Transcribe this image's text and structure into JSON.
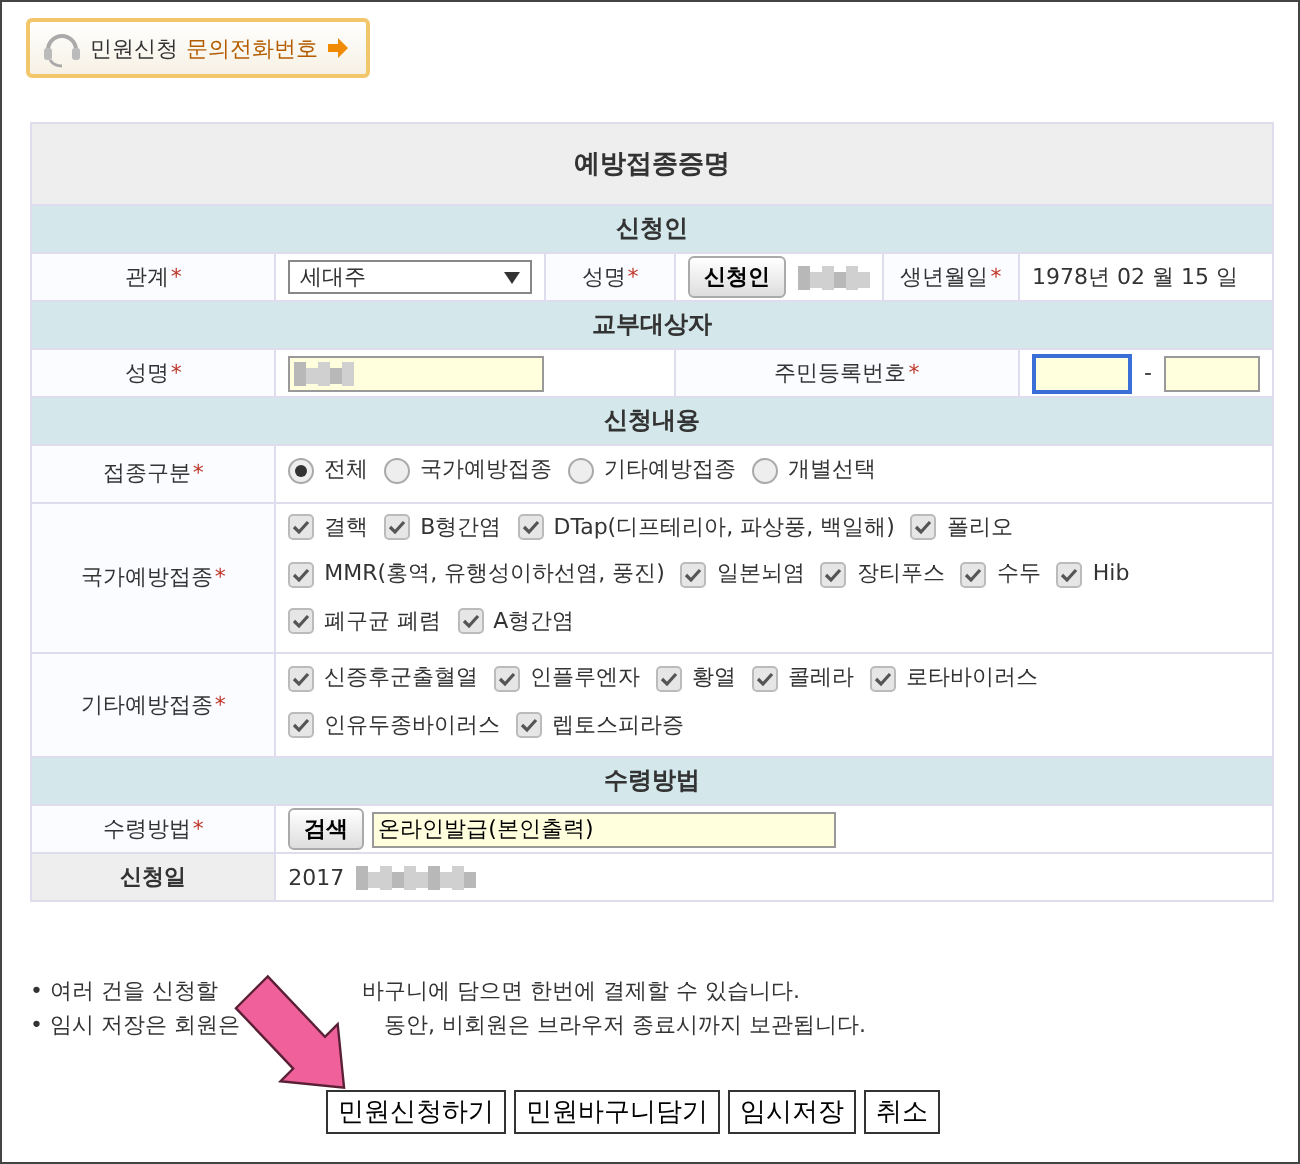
{
  "badge": {
    "label": "민원신청",
    "link": "문의전화번호"
  },
  "form": {
    "title": "예방접종증명",
    "applicant": {
      "heading": "신청인",
      "relation_label": "관계",
      "relation_mark": "*",
      "relation_value": "세대주",
      "name_label": "성명",
      "name_mark": "*",
      "name_button": "신청인",
      "birth_label": "생년월일",
      "birth_mark": "*",
      "birth_value": "1978년 02 월 15 일"
    },
    "recipient": {
      "heading": "교부대상자",
      "name_label": "성명",
      "name_mark": "*",
      "id_label": "주민등록번호",
      "id_mark": "*",
      "id_separator": "-"
    },
    "content": {
      "heading": "신청내용",
      "rows": [
        {
          "kind": "radio",
          "label": "접종구분",
          "mark": "*",
          "options": [
            {
              "label": "전체",
              "selected": true
            },
            {
              "label": "국가예방접종",
              "selected": false
            },
            {
              "label": "기타예방접종",
              "selected": false
            },
            {
              "label": "개별선택",
              "selected": false
            }
          ]
        },
        {
          "kind": "checkbox",
          "label": "국가예방접종",
          "mark": "*",
          "options": [
            {
              "label": "결핵",
              "checked": true
            },
            {
              "label": "B형간염",
              "checked": true
            },
            {
              "label": "DTap(디프테리아, 파상풍, 백일해)",
              "checked": true
            },
            {
              "label": "폴리오",
              "checked": true
            },
            {
              "label": "MMR(홍역, 유행성이하선염, 풍진)",
              "checked": true
            },
            {
              "label": "일본뇌염",
              "checked": true
            },
            {
              "label": "장티푸스",
              "checked": true
            },
            {
              "label": "수두",
              "checked": true
            },
            {
              "label": "Hib",
              "checked": true
            },
            {
              "label": "폐구균 폐렴",
              "checked": true
            },
            {
              "label": "A형간염",
              "checked": true
            }
          ]
        },
        {
          "kind": "checkbox",
          "label": "기타예방접종",
          "mark": "*",
          "options": [
            {
              "label": "신증후군출혈열",
              "checked": true
            },
            {
              "label": "인플루엔자",
              "checked": true
            },
            {
              "label": "황열",
              "checked": true
            },
            {
              "label": "콜레라",
              "checked": true
            },
            {
              "label": "로타바이러스",
              "checked": true
            },
            {
              "label": "인유두종바이러스",
              "checked": true
            },
            {
              "label": "렙토스피라증",
              "checked": true
            }
          ]
        }
      ]
    },
    "receipt": {
      "heading": "수령방법",
      "method_label": "수령방법",
      "method_mark": "*",
      "search_button": "검색",
      "method_value": "온라인발급(본인출력)",
      "date_label": "신청일",
      "date_value": "2017"
    }
  },
  "notes": [
    {
      "before": "• 여러 건을 신청할",
      "after": "바구니에 담으면 한번에 결제할 수 있습니다."
    },
    {
      "before": "• 임시 저장은 회원은",
      "after": "동안, 비회원은 브라우저 종료시까지 보관됩니다."
    }
  ],
  "buttons": [
    "민원신청하기",
    "민원바구니담기",
    "임시저장",
    "취소"
  ]
}
